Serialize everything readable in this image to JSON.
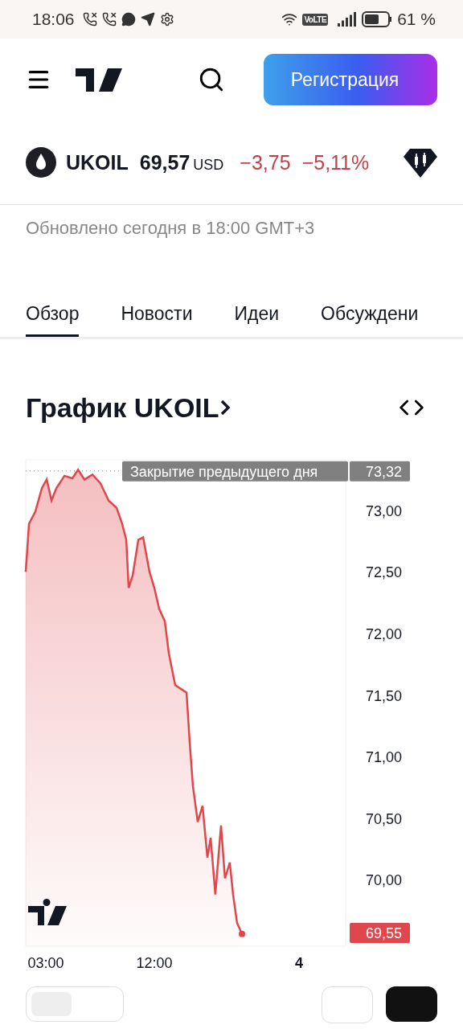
{
  "status_bar": {
    "time": "18:06",
    "network_badge": "VoLTE",
    "battery": "61 %"
  },
  "header": {
    "register_button": "Регистрация"
  },
  "symbol": {
    "name": "UKOIL",
    "price": "69,57",
    "currency": "USD",
    "change": "−3,75",
    "change_percent": "−5,11%"
  },
  "updated": "Обновлено сегодня в 18:00 GMT+3",
  "tabs": [
    {
      "label": "Обзор",
      "selected": true
    },
    {
      "label": "Новости",
      "selected": false
    },
    {
      "label": "Идеи",
      "selected": false
    },
    {
      "label": "Обсуждени",
      "selected": false
    }
  ],
  "chart": {
    "title": "График UKOIL",
    "previous_close": {
      "label": "Закрытие предыдущего дня",
      "value": "73,32"
    },
    "last_price": "69,55",
    "day_marker": "4",
    "chart_data": {
      "type": "area",
      "x": [
        1.33,
        1.6,
        2.13,
        2.67,
        3.07,
        3.47,
        3.87,
        4.54,
        5.2,
        5.67,
        6.2,
        6.86,
        7.53,
        8.2,
        8.87,
        9.33,
        9.67,
        9.87,
        10.2,
        10.67,
        11.07,
        11.6,
        12.0,
        12.4,
        12.87,
        13.2,
        13.73,
        14.2,
        14.67,
        14.93,
        15.2,
        15.6,
        16.0,
        16.4,
        16.67,
        17.06,
        17.53,
        17.86,
        18.26,
        18.53,
        18.86,
        19.27
      ],
      "series": [
        {
          "color": "#e0474c",
          "values": [
            72.5,
            72.89,
            72.99,
            73.18,
            73.25,
            73.08,
            73.18,
            73.28,
            73.26,
            73.33,
            73.25,
            73.29,
            73.22,
            73.08,
            73.02,
            72.89,
            72.76,
            72.37,
            72.47,
            72.76,
            72.78,
            72.5,
            72.37,
            72.2,
            72.1,
            71.84,
            71.58,
            71.55,
            71.52,
            71.12,
            70.76,
            70.47,
            70.6,
            70.18,
            70.34,
            69.88,
            70.44,
            70.01,
            70.14,
            69.88,
            69.65,
            69.56
          ]
        }
      ],
      "xlim": [
        1.33,
        27.87
      ],
      "ylim": [
        69.46,
        73.41
      ],
      "xticks": [
        {
          "value": 3,
          "label": "03:00"
        },
        {
          "value": 12,
          "label": "12:00"
        }
      ],
      "yticks": [
        {
          "value": 73,
          "label": "73,00"
        },
        {
          "value": 72.5,
          "label": "72,50"
        },
        {
          "value": 72,
          "label": "72,00"
        },
        {
          "value": 71.5,
          "label": "71,50"
        },
        {
          "value": 71,
          "label": "71,00"
        },
        {
          "value": 70.5,
          "label": "70,50"
        },
        {
          "value": 70,
          "label": "70,00"
        }
      ]
    }
  }
}
